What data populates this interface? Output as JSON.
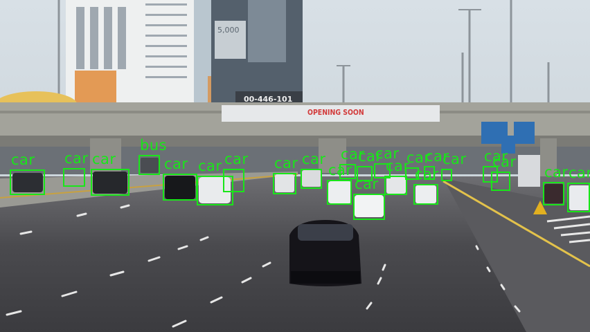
{
  "scene": {
    "type": "dashcam-frame-with-object-detections",
    "box_color": "#19e619"
  },
  "signage": {
    "banner_text": "OPENING SOON",
    "phone_text": "00-446-101",
    "billboard_text": "5,000"
  },
  "detections": [
    {
      "label": "car"
    },
    {
      "label": "car"
    },
    {
      "label": "car"
    },
    {
      "label": "bus"
    },
    {
      "label": "car"
    },
    {
      "label": "car"
    },
    {
      "label": "car"
    },
    {
      "label": "car"
    },
    {
      "label": "car"
    },
    {
      "label": "car"
    },
    {
      "label": "car"
    },
    {
      "label": "car"
    },
    {
      "label": "car"
    },
    {
      "label": "car"
    },
    {
      "label": "car"
    },
    {
      "label": "car"
    },
    {
      "label": "car"
    },
    {
      "label": "car"
    },
    {
      "label": "car"
    },
    {
      "label": "car"
    },
    {
      "label": "car"
    },
    {
      "label": "car"
    },
    {
      "label": "car"
    }
  ]
}
